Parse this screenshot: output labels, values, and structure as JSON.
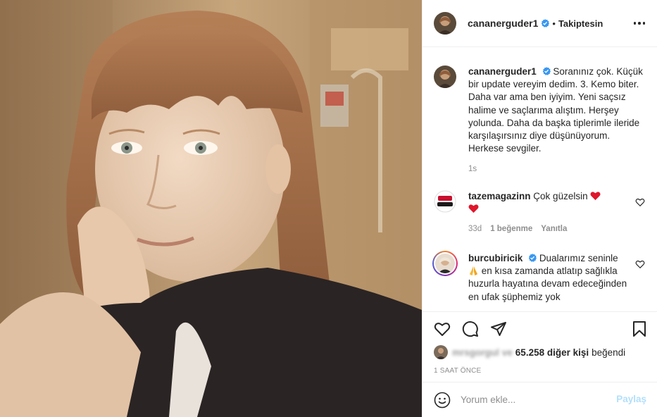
{
  "header": {
    "username": "cananerguder1",
    "separator": "•",
    "follow_status": "Takiptesin"
  },
  "caption": {
    "username": "cananerguder1",
    "text": "Soranınız çok. Küçük bir update vereyim dedim. 3. Kemo biter. Daha var ama ben iyiyim. Yeni saçsız halime ve saçlarıma alıştım. Herşey yolunda. Daha da başka tiplerimle ileride karşılaşırsınız diye düşünüyorum. Herkese sevgiler.",
    "time": "1s"
  },
  "comments": [
    {
      "username": "tazemagazinn",
      "text": "Çok güzelsin",
      "time": "33d",
      "likes": "1 beğenme",
      "reply": "Yanıtla"
    },
    {
      "username": "burcubiricik",
      "text_part1": "Dualarımız seninle",
      "text_part2": "en kısa zamanda atlatıp sağlıkla huzurla hayatına devam edeceğinden en ufak şüphemiz yok"
    }
  ],
  "likes": {
    "blurred_user": "mrsgorgul",
    "and": "ve",
    "count": "65.258 diğer kişi",
    "suffix": "beğendi"
  },
  "post_time": "1 SAAT ÖNCE",
  "comment_box": {
    "placeholder": "Yorum ekle...",
    "post_label": "Paylaş"
  },
  "colors": {
    "verified_blue": "#3897f0",
    "heart_red": "#ed4956",
    "post_button_disabled": "#b2dffc",
    "muted_text": "#8e8e8e"
  },
  "icons": [
    "more-options-icon",
    "verified-icon",
    "heart-icon",
    "comment-icon",
    "share-icon",
    "bookmark-icon",
    "emoji-icon"
  ]
}
